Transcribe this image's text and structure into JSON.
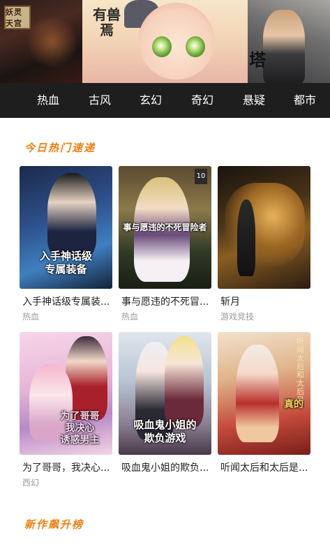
{
  "banner": {
    "slides": [
      {
        "name": "banner-slide-left",
        "stamp_text": "妖灵天宫"
      },
      {
        "name": "banner-slide-center",
        "logo_text": "有兽焉"
      },
      {
        "name": "banner-slide-right",
        "caption": "塔"
      }
    ]
  },
  "categories": [
    "热血",
    "古风",
    "玄幻",
    "奇幻",
    "悬疑",
    "都市"
  ],
  "sections": [
    {
      "title": "今日热门速递"
    },
    {
      "title": "新作飙升榜"
    }
  ],
  "comics": [
    {
      "name": "入手神话级专属装...",
      "tag": "热血",
      "cover_text": "入手神话级\n专属装备",
      "accent": "#3f7fc0"
    },
    {
      "name": "事与愿违的不死冒...",
      "tag": "热血",
      "cover_text": "事与愿违的不死冒险者",
      "volume": "10",
      "accent": "#8c7a4a"
    },
    {
      "name": "斩月",
      "tag": "游戏竞技",
      "cover_text": "",
      "accent": "#8a5e22"
    },
    {
      "name": "为了哥哥，我决心...",
      "tag": "西幻",
      "cover_text": "为了哥哥\n我决心\n诱惑男主",
      "accent": "#e8b8d8"
    },
    {
      "name": "吸血鬼小姐的欺负...",
      "tag": "",
      "cover_text": "吸血鬼小姐的\n欺负游戏",
      "accent": "#b8c4d4"
    },
    {
      "name": "听闻太后和太后是...",
      "tag": "",
      "cover_text": "真的",
      "vertical_text": "听闻太后和太后是",
      "accent": "#c44a3a"
    }
  ],
  "colors": {
    "nav_bg": "#1e1e1e",
    "section_title": "#f07f10",
    "tag_text": "#9a9a9a"
  }
}
